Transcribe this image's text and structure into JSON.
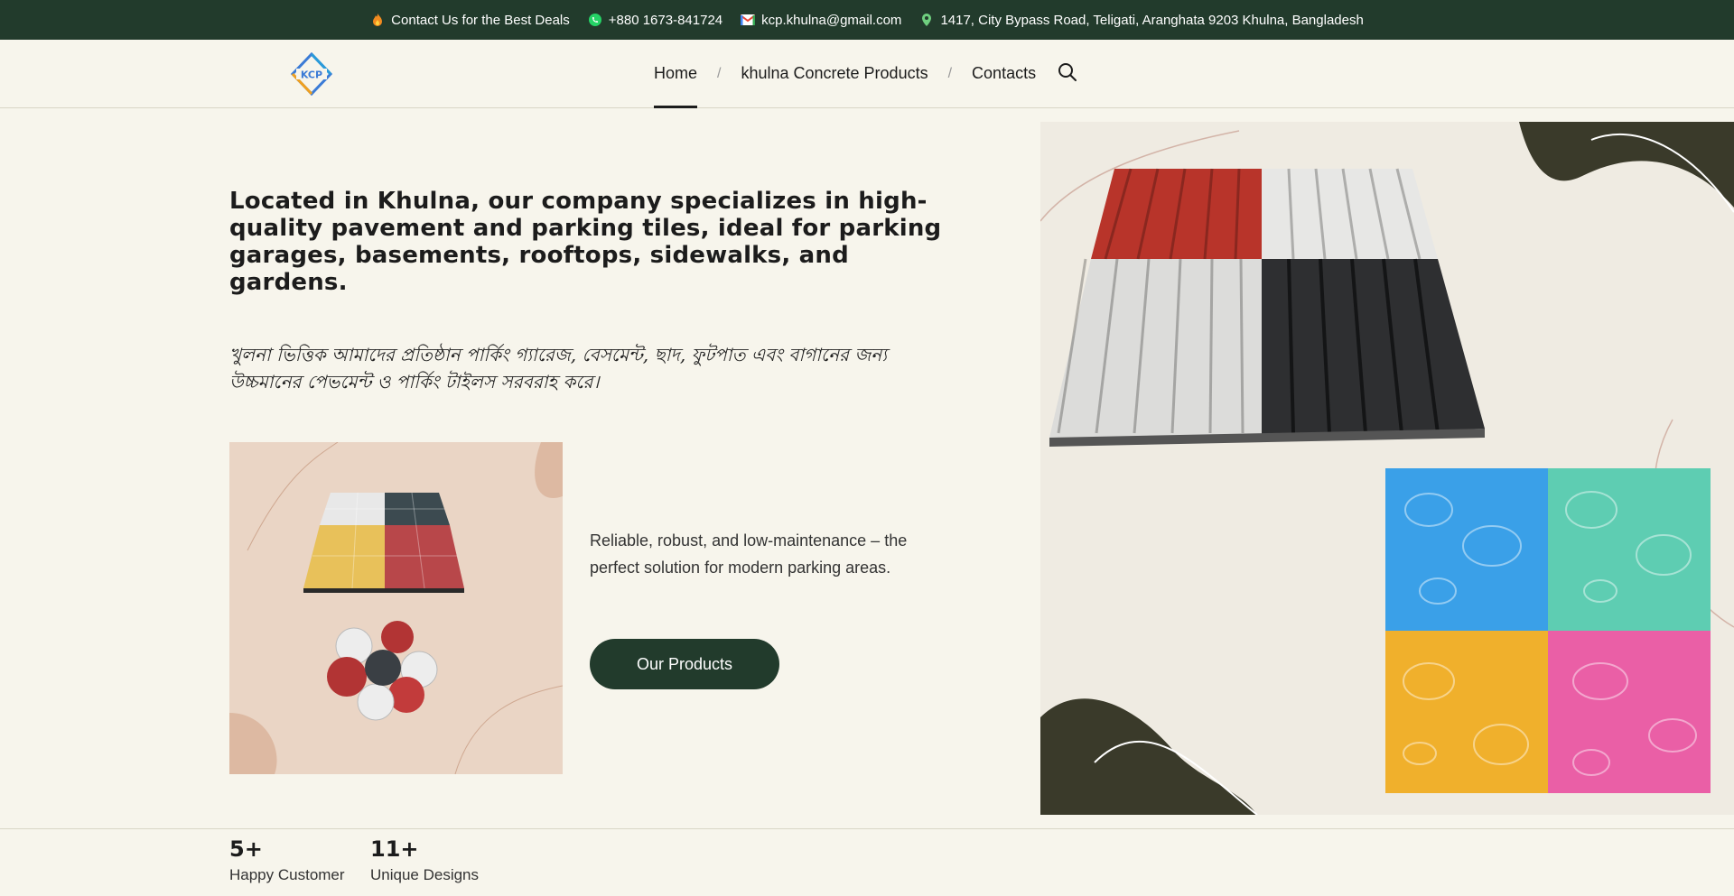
{
  "topbar": {
    "items": [
      {
        "icon": "fire-icon",
        "text": "Contact Us for the Best Deals"
      },
      {
        "icon": "whatsapp-icon",
        "text": "+880 1673-841724"
      },
      {
        "icon": "gmail-icon",
        "text": "kcp.khulna@gmail.com"
      },
      {
        "icon": "location-icon",
        "text": "1417, City Bypass Road, Teligati, Aranghata 9203 Khulna, Bangladesh"
      }
    ]
  },
  "header": {
    "logo_text": "KCP",
    "nav": [
      {
        "label": "Home",
        "active": true
      },
      {
        "label": "khulna Concrete Products"
      },
      {
        "label": "Contacts"
      }
    ],
    "separator": "/",
    "search_icon": "search-icon"
  },
  "hero": {
    "headline": "Located in Khulna, our company specializes in high-quality pavement and parking tiles, ideal for parking garages, basements, rooftops, sidewalks, and gardens.",
    "bangla": "খুলনা ভিত্তিক আমাদের প্রতিষ্ঠান পার্কিং গ্যারেজ, বেসমেন্ট, ছাদ, ফুটপাত এবং বাগানের জন্য উচ্চমানের পেভমেন্ট ও পার্কিং টাইলস সরবরাহ করে।",
    "description": "Reliable, robust, and low-maintenance – the perfect solution for modern parking areas.",
    "button_label": "Our Products"
  },
  "stats": [
    {
      "number": "5+",
      "label": "Happy Customer"
    },
    {
      "number": "11+",
      "label": "Unique Designs"
    }
  ],
  "colors": {
    "brand_dark": "#223b2c",
    "background": "#f7f5ec",
    "card_bg": "#ead5c5"
  }
}
